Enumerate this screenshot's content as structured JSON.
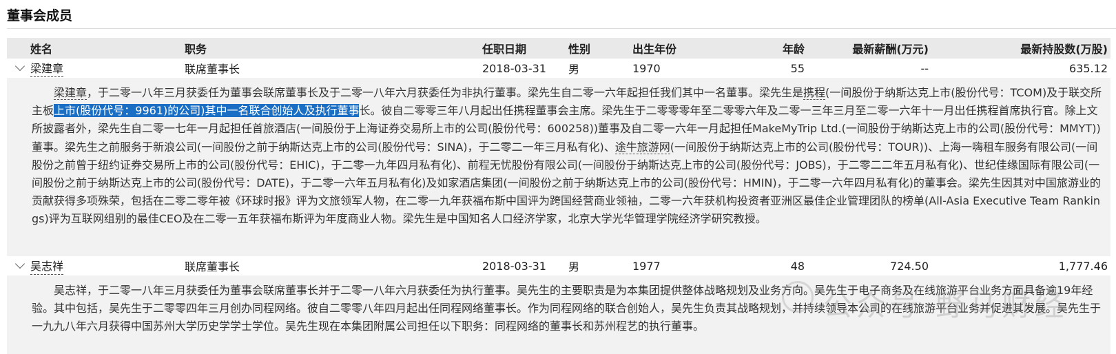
{
  "section_title": "董事会成员",
  "table": {
    "headers": {
      "name": "姓名",
      "role": "职务",
      "appoint_date": "任职日期",
      "gender": "性别",
      "birth_year": "出生年份",
      "age": "年龄",
      "salary": "最新薪酬(万元)",
      "shares": "最新持股数(万股)"
    },
    "rows": [
      {
        "name": "梁建章",
        "role": "联席董事长",
        "appoint_date": "2018-03-31",
        "gender": "男",
        "birth_year": "1970",
        "age": "55",
        "salary": "--",
        "shares": "635.12",
        "expanded": true,
        "bio": {
          "name_ref": "梁建章",
          "p1": "，于二零一八年三月获委任为董事会联席董事长及于二零一八年六月获委任为非执行董事。梁先生自二零一六年起担任我们其中一名董事。梁先生是",
          "link1": "携程",
          "p2": "(一间股份于纳斯达克上市(股份代号：TCOM)及于联交所主板",
          "highlight": "上市(股份代号：9961)的公司)其中一名联合创始人及执行董事",
          "p3": "长。彼自二零零三年八月起出任携程董事会主席。梁先生于二零零零年至二零零六年及二零一三年三月至二零一六年十一月出任携程首席执行官。除上文所披露者外，梁先生自二零一七年一月起担任首旅酒店(一间股份于上海证券交易所上市的公司(股份代号：600258))董事及自二零一六年一月起担任MakeMyTrip Ltd.(一间股份于纳斯达克上市的公司(股份代号：MMYT))董事。梁先生之前服务于新浪公司(一间股份之前于纳斯达克上市的公司(股份代号：SINA)，于二零二一年三月私有化)、",
          "link2": "途牛旅游网",
          "p4": "(一间股份于纳斯达克上市的公司(股份代号：TOUR))、上海一嗨租车服务有限公司(一间股份之前曾于纽约证券交易所上市的公司(股份代号：EHIC)，于二零一九年四月私有化)、前程无忧股份有限公司(一间股份于纳斯达克上市的公司(股份代号：JOBS)，于二零二二年五月私有化)、世纪佳缘国际有限公司(一间股份之前于纳斯达克上市的公司(股份代号：DATE)，于二零一六年五月私有化)及如家酒店集团(一间股份之前于纳斯达克上市的公司(股份代号：HMIN)，于二零一六年四月私有化)的董事会。梁先生因其对中国旅游业的贡献获得多项殊荣，包括在二零二零年被《环球时报》评为文旅领军人物，在二零一九年获福布斯中国评为跨国经营商业领袖，二零一六年获机构投资者亚洲区最佳企业管理团队的榜单(All-Asia Executive Team Rankings)评为互联网组别的最佳CEO及在二零一五年获福布斯评为年度商业人物。梁先生是中国知名人口经济学家，北京大学光华管理学院经济学研究教授。"
        }
      },
      {
        "name": "吴志祥",
        "role": "联席董事长",
        "appoint_date": "2018-03-31",
        "gender": "男",
        "birth_year": "1977",
        "age": "48",
        "salary": "724.50",
        "shares": "1,777.46",
        "expanded": true,
        "bio": {
          "text": "吴志祥，于二零一八年三月获委任为董事会联席董事长并于二零一八年六月获委任为执行董事。吴先生的主要职责是为本集团提供整体战略规划及业务方向。吴先生于电子商务及在线旅游平台业务方面具备逾19年经验。其中包括，吴先生于二零零四年三月创办同程网络。彼自二零零八年四月起出任同程网络董事长。作为同程网络的联合创始人，吴先生负责其战略规划，并持续领导本公司的在线旅游平台业务并促进其发展。吴先生于一九九八年六月获得中国苏州大学历史学学士学位。吴先生现在本集团附属公司担任以下职务：同程网络的董事长和苏州程艺的执行董事。"
        }
      }
    ]
  },
  "watermark": {
    "text": "公众号·野马财经"
  }
}
